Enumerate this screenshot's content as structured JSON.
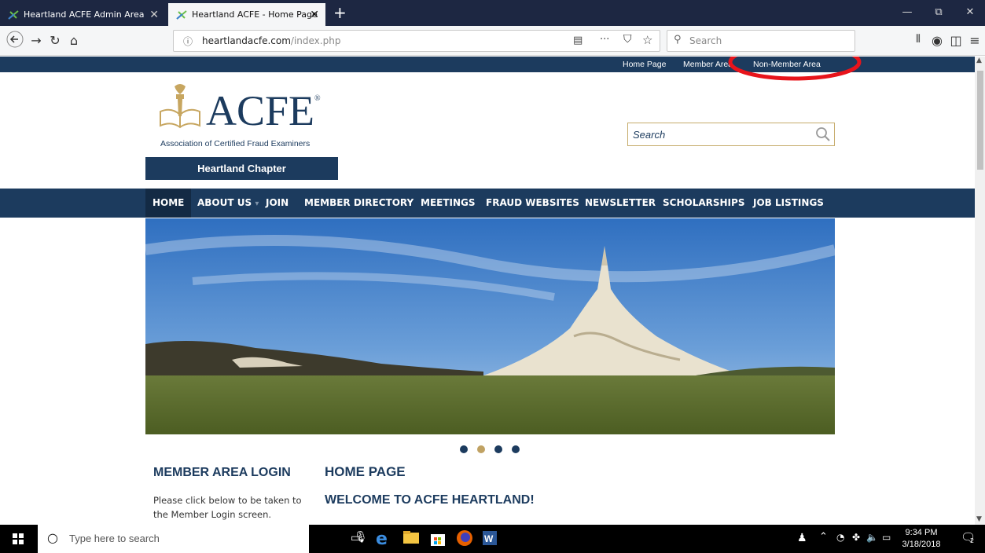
{
  "browser": {
    "tabs": [
      {
        "title": "Heartland ACFE Admin Area",
        "active": false
      },
      {
        "title": "Heartland ACFE - Home Page",
        "active": true
      }
    ],
    "new_tab": "+",
    "window_controls": {
      "minimize": "—",
      "restore": "⧉",
      "close": "✕"
    },
    "url_host": "heartlandacfe.com",
    "url_path": "/index.php",
    "search_placeholder": "Search",
    "page_actions": "···"
  },
  "site": {
    "utility_links": [
      "Home Page",
      "Member Area",
      "Non-Member Area"
    ],
    "logo_text": "ACFE",
    "logo_reg": "®",
    "association": "Association of Certified Fraud Examiners",
    "chapter": "Heartland Chapter",
    "search_placeholder": "Search",
    "nav": [
      "HOME",
      "ABOUT US",
      "JOIN",
      "MEMBER DIRECTORY",
      "MEETINGS",
      "FRAUD WEBSITES",
      "NEWSLETTER",
      "SCHOLARSHIPS",
      "JOB LISTINGS"
    ],
    "nav_dropdown_caret": "▾",
    "slider_dots": 4,
    "slider_active_dot": 1,
    "sidebar_heading": "MEMBER AREA LOGIN",
    "sidebar_text": "Please click below to be taken to the Member Login screen.",
    "main_heading": "HOME PAGE",
    "main_subheading": "WELCOME TO ACFE HEARTLAND!",
    "annotation_color": "#e8141b"
  },
  "taskbar": {
    "search_placeholder": "Type here to search",
    "time": "9:34 PM",
    "date": "3/18/2018",
    "notification_count": "2"
  }
}
